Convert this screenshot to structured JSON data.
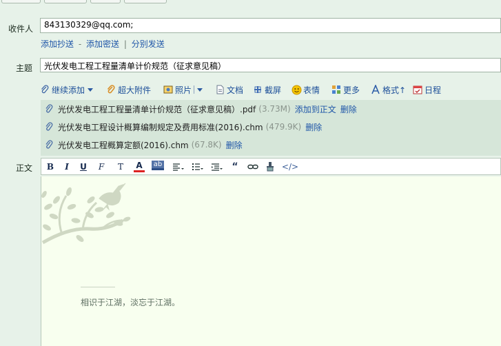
{
  "labels": {
    "to": "收件人",
    "subject": "主题",
    "body": "正文"
  },
  "to_field": {
    "value": "843130329@qq.com;"
  },
  "recipient_links": {
    "add_cc": "添加抄送",
    "dash": "-",
    "add_bcc": "添加密送",
    "pipe": "|",
    "separate_send": "分别发送"
  },
  "subject_field": {
    "value": "光伏发电工程工程量清单计价规范（征求意见稿）"
  },
  "toolbar": {
    "continue_add": "继续添加",
    "large_attachment": "超大附件",
    "photo": "照片",
    "document": "文档",
    "screenshot": "截屏",
    "emoji": "表情",
    "more": "更多",
    "format": "格式↑",
    "schedule": "日程"
  },
  "attachments": [
    {
      "name": "光伏发电工程工程量清单计价规范（征求意见稿）.pdf",
      "size": "(3.73M)",
      "extra_action": "添加到正文",
      "delete": "删除"
    },
    {
      "name": "光伏发电工程设计概算编制规定及费用标准(2016).chm",
      "size": "(479.9K)",
      "delete": "删除"
    },
    {
      "name": "光伏发电工程概算定额(2016).chm",
      "size": "(67.8K)",
      "delete": "删除"
    }
  ],
  "editor_toolbar": {
    "bold": "B",
    "italic": "I",
    "underline": "U",
    "font": "F",
    "font_size": "T",
    "font_color": "A",
    "background": "ab",
    "quote": "“",
    "source": "</>"
  },
  "signature": "相识于江湖，淡忘于江湖。",
  "colors": {
    "page_bg": "#e7f2e9",
    "attachment_bg": "#d6e6d9",
    "editor_bg": "#f8ffef",
    "link": "#1f56a8"
  }
}
